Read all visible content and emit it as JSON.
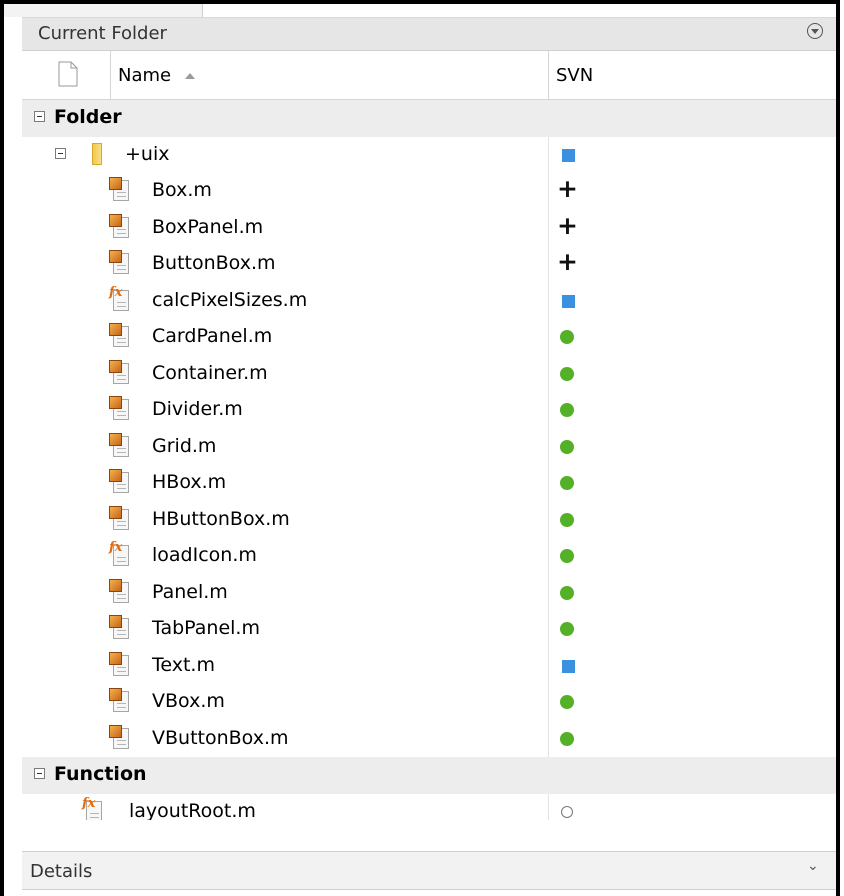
{
  "panel": {
    "title": "Current Folder"
  },
  "columns": {
    "name": "Name",
    "svn": "SVN"
  },
  "groups": [
    {
      "label": "Folder"
    },
    {
      "label": "Function"
    }
  ],
  "folder": {
    "name": "+uix",
    "svn": "square"
  },
  "files": [
    {
      "name": "Box.m",
      "icon": "class-file-icon",
      "svn": "plus"
    },
    {
      "name": "BoxPanel.m",
      "icon": "class-file-icon",
      "svn": "plus"
    },
    {
      "name": "ButtonBox.m",
      "icon": "class-file-icon",
      "svn": "plus"
    },
    {
      "name": "calcPixelSizes.m",
      "icon": "function-file-icon",
      "svn": "square"
    },
    {
      "name": "CardPanel.m",
      "icon": "class-file-icon",
      "svn": "dot"
    },
    {
      "name": "Container.m",
      "icon": "class-file-icon",
      "svn": "dot"
    },
    {
      "name": "Divider.m",
      "icon": "class-file-icon",
      "svn": "dot"
    },
    {
      "name": "Grid.m",
      "icon": "class-file-icon",
      "svn": "dot"
    },
    {
      "name": "HBox.m",
      "icon": "class-file-icon",
      "svn": "dot"
    },
    {
      "name": "HButtonBox.m",
      "icon": "class-file-icon",
      "svn": "dot"
    },
    {
      "name": "loadIcon.m",
      "icon": "function-file-icon",
      "svn": "dot"
    },
    {
      "name": "Panel.m",
      "icon": "class-file-icon",
      "svn": "dot"
    },
    {
      "name": "TabPanel.m",
      "icon": "class-file-icon",
      "svn": "dot"
    },
    {
      "name": "Text.m",
      "icon": "class-file-icon",
      "svn": "square"
    },
    {
      "name": "VBox.m",
      "icon": "class-file-icon",
      "svn": "dot"
    },
    {
      "name": "VButtonBox.m",
      "icon": "class-file-icon",
      "svn": "dot"
    }
  ],
  "functions": [
    {
      "name": "layoutRoot.m",
      "icon": "function-file-icon",
      "svn": "ring"
    }
  ],
  "details": {
    "title": "Details"
  },
  "colors": {
    "svn_modified": "#3a91e0",
    "svn_normal": "#54b026",
    "header_bg": "#e6e6e6",
    "group_bg": "#ededed"
  }
}
